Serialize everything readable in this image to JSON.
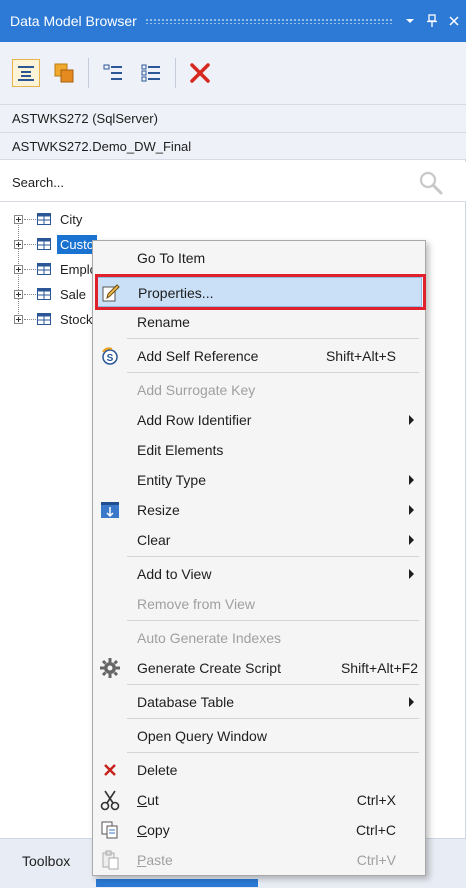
{
  "panel": {
    "title": "Data Model Browser",
    "dropdown_glyph": "▾",
    "pin_glyph": "📌",
    "close_glyph": "✕"
  },
  "toolbar": {
    "tools": [
      "collapse-all-icon",
      "entity-icon",
      "list-icon",
      "details-list-icon",
      "delete-icon"
    ]
  },
  "connection": "ASTWKS272 (SqlServer)",
  "database": "ASTWKS272.Demo_DW_Final",
  "search": {
    "placeholder": "Search..."
  },
  "tree": {
    "items": [
      {
        "label": "City",
        "selected": false
      },
      {
        "label": "Custo",
        "selected": true
      },
      {
        "label": "Emplo",
        "selected": false
      },
      {
        "label": "Sale",
        "selected": false
      },
      {
        "label": "Stock",
        "selected": false
      }
    ]
  },
  "bottom": {
    "tab": "Toolbox"
  },
  "menu": {
    "go_to_item": "Go To Item",
    "properties": "Properties...",
    "rename": "Rename",
    "add_self_reference": "Add Self Reference",
    "add_self_reference_shortcut": "Shift+Alt+S",
    "add_surrogate_key": "Add Surrogate Key",
    "add_row_identifier": "Add Row Identifier",
    "edit_elements": "Edit Elements",
    "entity_type": "Entity Type",
    "resize": "Resize",
    "clear": "Clear",
    "add_to_view": "Add to View",
    "remove_from_view": "Remove from View",
    "auto_generate_indexes": "Auto Generate Indexes",
    "generate_create_script": "Generate Create Script",
    "generate_create_script_shortcut": "Shift+Alt+F2",
    "database_table": "Database Table",
    "open_query_window": "Open Query Window",
    "delete": "Delete",
    "cut_u": "C",
    "cut_rest": "ut",
    "cut_shortcut": "Ctrl+X",
    "copy_u": "C",
    "copy_rest": "opy",
    "copy_shortcut": "Ctrl+C",
    "paste_u": "P",
    "paste_rest": "aste",
    "paste_shortcut": "Ctrl+V"
  },
  "colors": {
    "accent": "#2c7ad6",
    "selection": "#1a73d1",
    "highlight": "#c9e0f7",
    "callout": "#e0202a"
  }
}
